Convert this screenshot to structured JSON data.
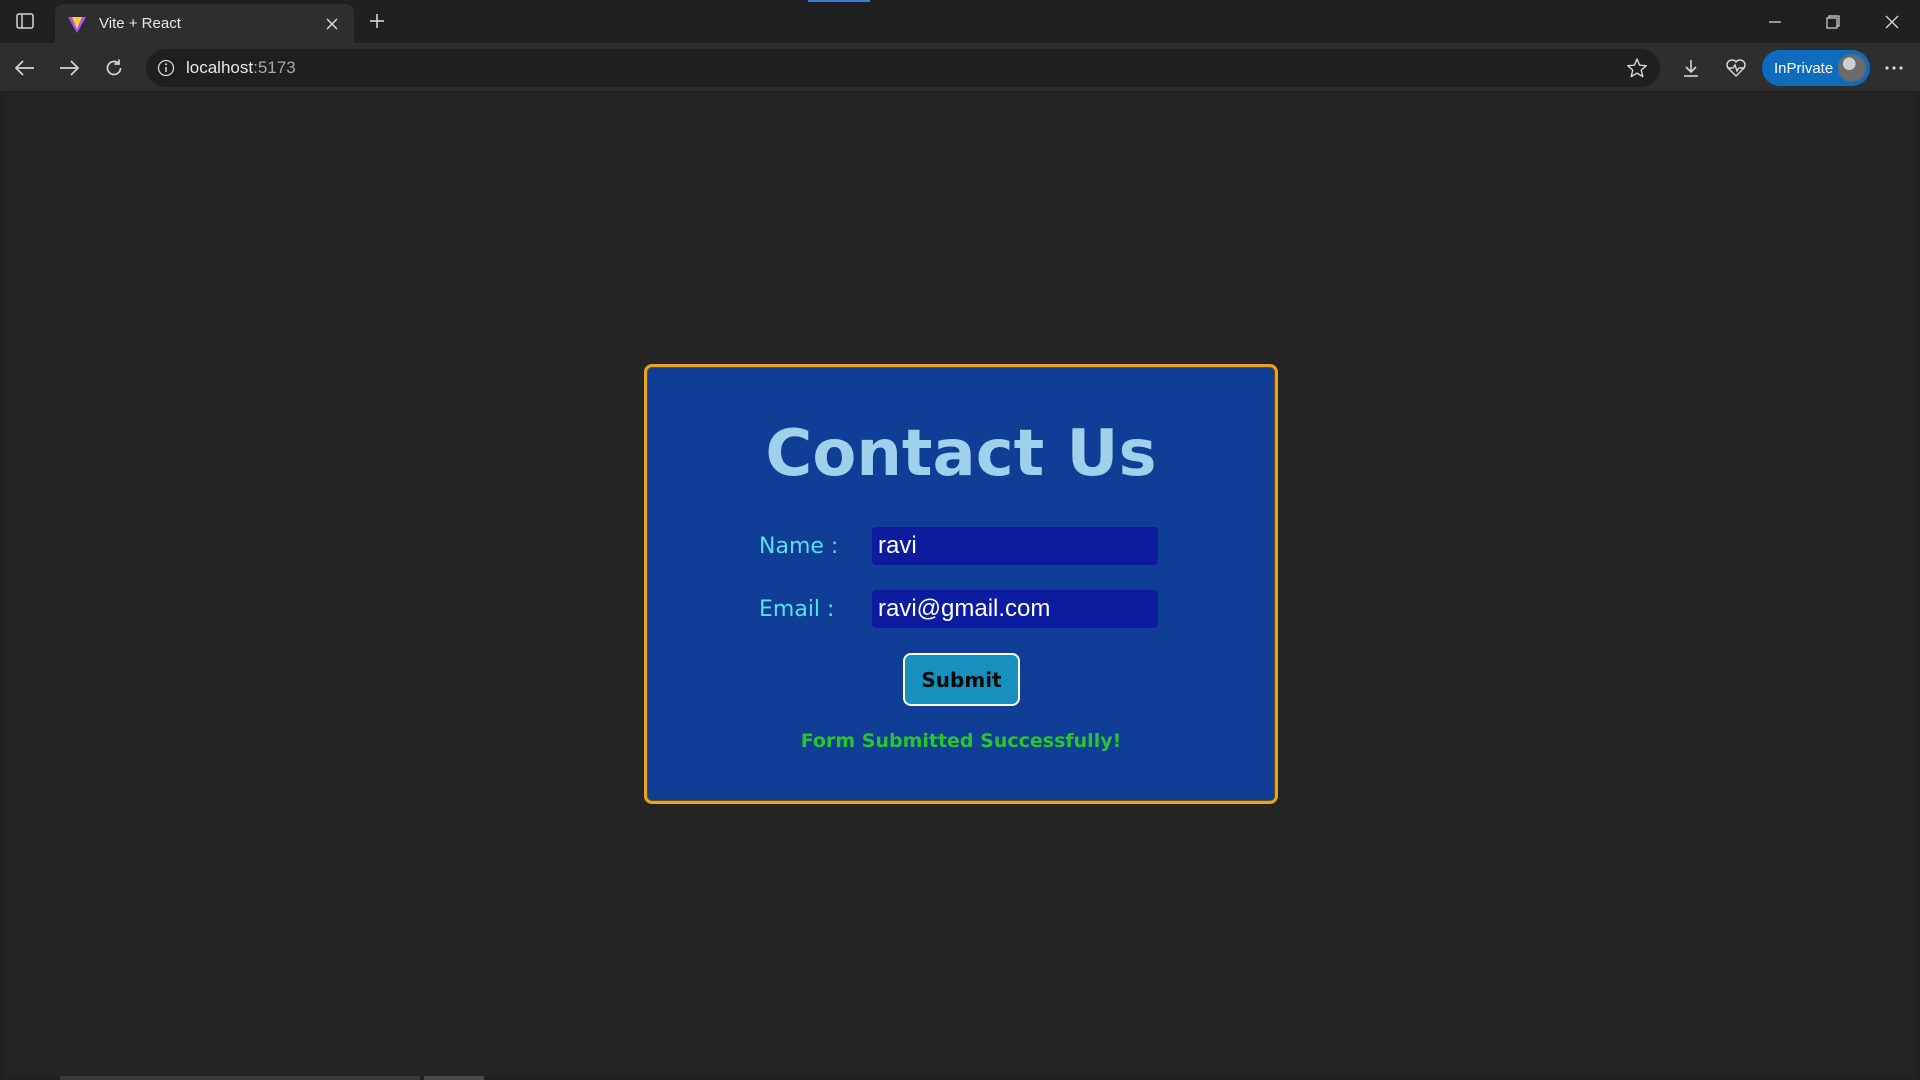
{
  "browser": {
    "tab_title": "Vite + React",
    "url_host": "localhost",
    "url_port": ":5173",
    "inprivate_label": "InPrivate"
  },
  "contact": {
    "title": "Contact Us",
    "name_label": "Name :",
    "name_value": "ravi",
    "email_label": "Email :",
    "email_value": "ravi@gmail.com",
    "submit_label": "Submit",
    "status_message": "Form Submitted Successfully!"
  },
  "colors": {
    "card_bg": "#103d96",
    "card_border": "#e7a325",
    "title": "#9fd0ec",
    "labels": "#52e3f0",
    "input_bg": "#0c1c9e",
    "button_bg": "#1691bf",
    "success": "#29c52e"
  },
  "icons": [
    "tab-actions-icon",
    "vite-favicon-icon",
    "close-icon",
    "plus-icon",
    "minimize-icon",
    "restore-icon",
    "window-close-icon",
    "back-arrow-icon",
    "forward-arrow-icon",
    "refresh-icon",
    "info-icon",
    "star-icon",
    "download-icon",
    "heartbeat-icon",
    "more-icon"
  ]
}
